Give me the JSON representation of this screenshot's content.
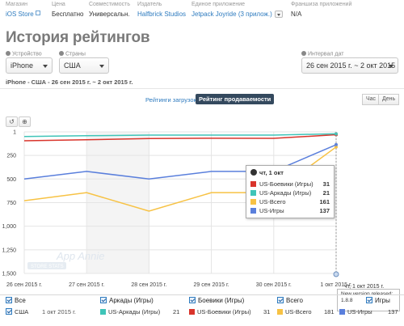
{
  "meta": {
    "store": {
      "label": "Магазин",
      "value": "iOS Store"
    },
    "price": {
      "label": "Цена",
      "value": "Бесплатно"
    },
    "compat": {
      "label": "Совместимость",
      "value": "Универсальн."
    },
    "publisher": {
      "label": "Издатель",
      "value": "Halfbrick Studios"
    },
    "unified": {
      "label": "Единое приложение",
      "value": "Jetpack Joyride",
      "count": "(3 прилож.)"
    },
    "franchise": {
      "label": "Франшиза приложений",
      "value": "N/A"
    }
  },
  "page_title": "История рейтингов",
  "filters": {
    "device": {
      "label": "Устройство",
      "value": "iPhone"
    },
    "country": {
      "label": "Страны",
      "value": "США"
    },
    "interval": {
      "label": "Интервал дат",
      "value": "26 сен 2015 г. ~ 2 окт 2015 г."
    }
  },
  "subtitle": "iPhone - США - 26 сен 2015 г. ~ 2 окт 2015 г.",
  "tabs": {
    "downloads": "Рейтинги загрузок",
    "grossing": "Рейтинг продаваемости"
  },
  "granularity": {
    "hour": "Час",
    "day": "День"
  },
  "tools": {
    "reset": "↺",
    "zoom": "⊕"
  },
  "watermark": {
    "brand": "App Annie",
    "sub": "STORE STATS"
  },
  "colors": {
    "red": "#d9342b",
    "teal": "#3fc4b8",
    "yellow": "#f7c244",
    "blue": "#5a7fdc"
  },
  "chart_data": {
    "type": "line",
    "x": [
      "26 сен 2015 г.",
      "27 сен 2015 г.",
      "28 сен 2015 г.",
      "29 сен 2015 г.",
      "30 сен 2015 г.",
      "1 окт 2015 г."
    ],
    "y_ticks": [
      "1",
      "250",
      "500",
      "750",
      "1,000",
      "1,250",
      "1,500"
    ],
    "ylim": [
      1,
      1500
    ],
    "y_inverted": true,
    "grid": true,
    "series": [
      {
        "name": "US-Боевики (Игры)",
        "color": "#d9342b",
        "values": [
          95,
          85,
          72,
          68,
          70,
          31
        ]
      },
      {
        "name": "US-Аркады (Игры)",
        "color": "#3fc4b8",
        "values": [
          50,
          42,
          35,
          35,
          35,
          21
        ]
      },
      {
        "name": "US-Всего",
        "color": "#f7c244",
        "values": [
          730,
          645,
          840,
          645,
          645,
          161
        ]
      },
      {
        "name": "US-Игры",
        "color": "#5a7fdc",
        "values": [
          500,
          420,
          500,
          420,
          420,
          137
        ]
      }
    ],
    "tooltip": {
      "title": "чт, 1 окт",
      "rows": [
        {
          "name": "US-Боевики (Игры)",
          "value": "31",
          "color": "#d9342b"
        },
        {
          "name": "US-Аркады (Игры)",
          "value": "21",
          "color": "#3fc4b8"
        },
        {
          "name": "US-Всего",
          "value": "161",
          "color": "#f7c244"
        },
        {
          "name": "US-Игры",
          "value": "137",
          "color": "#5a7fdc"
        }
      ]
    },
    "annotation": {
      "date": "чт, 1 окт 2015 г.",
      "line1": "New version released:",
      "line2": "1.8.8"
    }
  },
  "legend": {
    "all": "Все",
    "headers": [
      "Аркады (Игры)",
      "Боевики (Игры)",
      "Всего",
      "Игры"
    ],
    "row": {
      "country": "США",
      "date": "1 окт 2015 г.",
      "items": [
        {
          "name": "US-Аркады (Игры)",
          "value": "21",
          "color": "#3fc4b8"
        },
        {
          "name": "US-Боевики (Игры)",
          "value": "31",
          "color": "#d9342b"
        },
        {
          "name": "US-Всего",
          "value": "181",
          "color": "#f7c244"
        },
        {
          "name": "US-Игры",
          "value": "137",
          "color": "#5a7fdc"
        }
      ]
    }
  }
}
